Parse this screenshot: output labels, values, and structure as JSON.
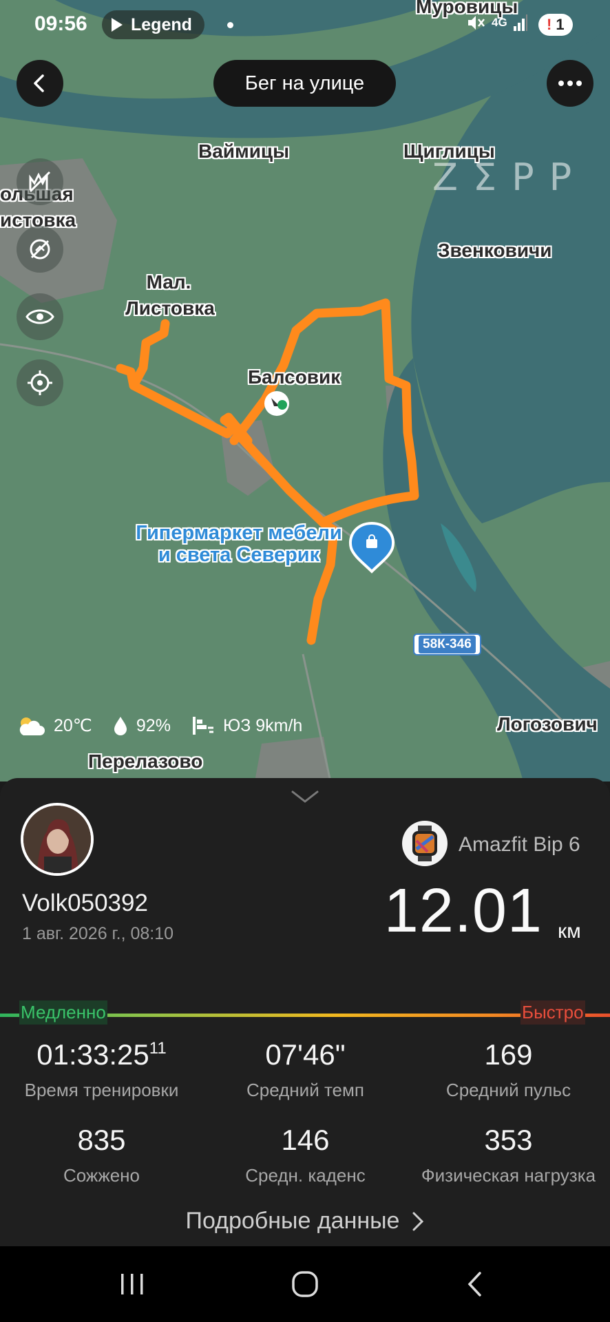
{
  "status_bar": {
    "time": "09:56",
    "media_label": "Legend",
    "network": "4G",
    "alert_count": "1"
  },
  "nav": {
    "title": "Бег на улице"
  },
  "map": {
    "watermark": "ZΣPP",
    "places": {
      "murovitsy": "Муровицы",
      "vaimitsy": "Ваймицы",
      "shchiglitsy": "Щиглицы",
      "bolshaya_listovka_1": "ольшая",
      "bolshaya_listovka_2": "истовка",
      "zvenkovichi": "Звенковичи",
      "mal_listovka_1": "Мал.",
      "mal_listovka_2": "Листовка",
      "balsovik": "Балсовик",
      "logozovichi": "Логозович",
      "perelazovo": "Перелазово"
    },
    "poi": {
      "line1": "Гипермаркет мебели",
      "line2": "и света Северик"
    },
    "road": "58К-346"
  },
  "weather": {
    "temperature": "20℃",
    "humidity": "92%",
    "wind": "ЮЗ 9km/h"
  },
  "summary": {
    "username": "Volk050392",
    "datetime": "1 авг. 2026 г., 08:10",
    "device": "Amazfit Bip 6",
    "distance": "12.01",
    "distance_unit": "км",
    "pace_slow_label": "Медленно",
    "pace_fast_label": "Быстро",
    "stats": [
      {
        "value": "01:33:25",
        "sup": "11",
        "label": "Время тренировки"
      },
      {
        "value": "07'46\"",
        "sup": "",
        "label": "Средний темп"
      },
      {
        "value": "169",
        "sup": "",
        "label": "Средний пульс"
      },
      {
        "value": "835",
        "sup": "",
        "label": "Сожжено"
      },
      {
        "value": "146",
        "sup": "",
        "label": "Средн. каденс"
      },
      {
        "value": "353",
        "sup": "",
        "label": "Физическая нагрузка"
      }
    ],
    "details_label": "Подробные данные"
  },
  "colors": {
    "route": "#ff8a1c",
    "land": "#5f8a6e",
    "water": "#3f6f74",
    "panel": "#1f1f1f",
    "accent_blue": "#2f8bd8"
  },
  "icons": [
    "back-icon",
    "more-icon",
    "heatmap-toggle-icon",
    "hide-route-icon",
    "eye-icon",
    "locate-icon",
    "weather-cloud-icon",
    "humidity-icon",
    "wind-icon",
    "shopping-bag-icon",
    "chevron-down-icon",
    "chevron-right-icon",
    "recents-icon",
    "home-icon",
    "nav-back-icon"
  ]
}
